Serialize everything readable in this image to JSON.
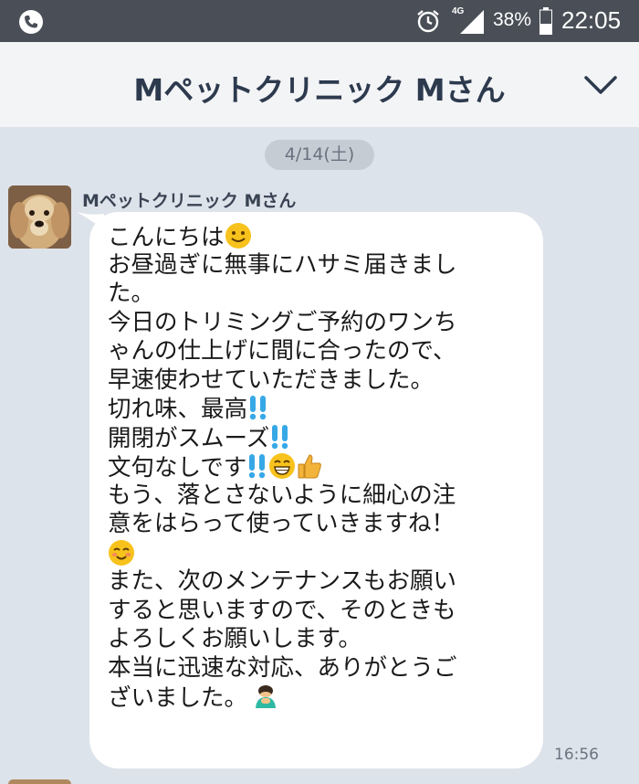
{
  "status_bar": {
    "network": "4G",
    "battery": "38%",
    "time": "22:05"
  },
  "header": {
    "title": "Mペットクリニック Mさん"
  },
  "chat": {
    "date_label": "4/14(土)",
    "message": {
      "sender": "Mペットクリニック Mさん",
      "time": "16:56",
      "lines": [
        "こんにちは",
        "お昼過ぎに無事にハサミ届きまし",
        "た。",
        "今日のトリミングご予約のワンち",
        "ゃんの仕上げに間に合ったので、",
        "早速使わせていただきました。",
        "切れ味、最高",
        "開閉がスムーズ",
        "文句なしです",
        "もう、落とさないように細心の注",
        "意をはらって使っていきますね！",
        "",
        "また、次のメンテナンスもお願い",
        "すると思いますので、そのときも",
        "よろしくお願いします。",
        "本当に迅速な対応、ありがとうご",
        "ざいました。"
      ],
      "emojis": {
        "line_0": "smiling-face-emoji",
        "line_6": "double-exclamation-emoji",
        "line_7": "double-exclamation-emoji",
        "line_8": "double-exclamation-grin-thumbs-up-emoji",
        "line_11": "blushing-smile-emoji",
        "line_16": "bowing-person-emoji"
      }
    }
  },
  "colors": {
    "background": "#dde3ea",
    "status_bar": "#4a4f57",
    "header": "#f3f4f6",
    "bubble": "#ffffff",
    "accent_blue": "#37a8e6"
  }
}
